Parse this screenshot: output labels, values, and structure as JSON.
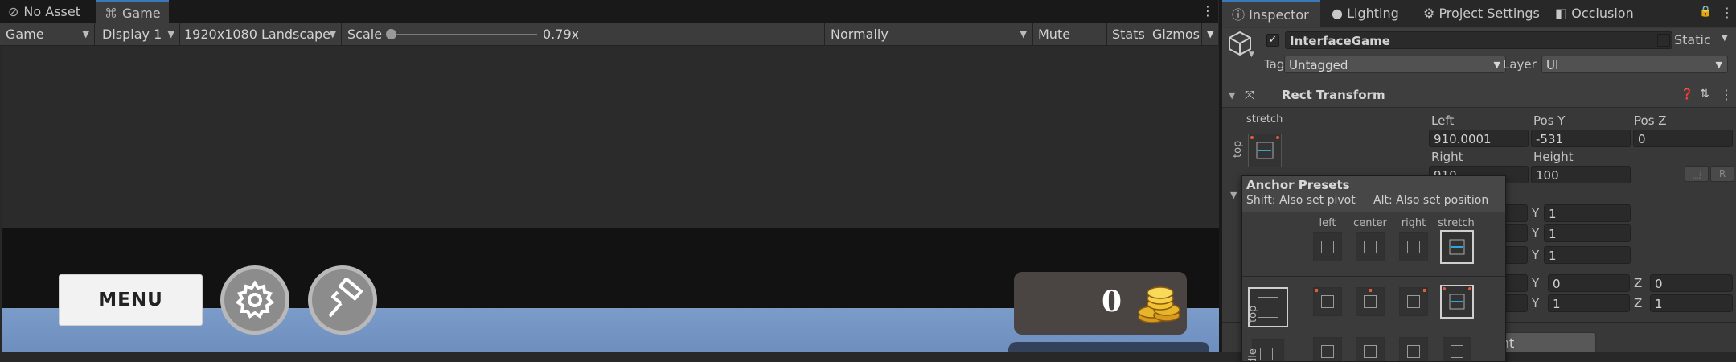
{
  "game_panel": {
    "tabs": [
      {
        "label": "No Asset",
        "icon": "unlink-icon"
      },
      {
        "label": "Game",
        "icon": "gamepad-icon"
      }
    ],
    "toolbar": {
      "view_mode": "Game",
      "display": "Display 1",
      "resolution": "1920x1080 Landscape",
      "scale_label": "Scale",
      "scale_value": "0.79x",
      "play_focus": "Normally",
      "mute_audio": "Mute Audio",
      "stats": "Stats",
      "gizmos": "Gizmos"
    },
    "view": {
      "menu_label": "MENU",
      "coin_count": "0"
    }
  },
  "inspector": {
    "tabs": [
      "Inspector",
      "Lighting",
      "Project Settings",
      "Occlusion"
    ],
    "gameobject": {
      "active": true,
      "name": "InterfaceGame",
      "static_label": "Static",
      "tag_label": "Tag",
      "tag_value": "Untagged",
      "layer_label": "Layer",
      "layer_value": "UI"
    },
    "rect_transform": {
      "title": "Rect Transform",
      "anchor_h": "stretch",
      "anchor_v": "top",
      "left_label": "Left",
      "left_value": "910.0001",
      "posy_label": "Pos Y",
      "posy_value": "-531",
      "posz_label": "Pos Z",
      "posz_value": "0",
      "right_label": "Right",
      "right_value": "910",
      "height_label": "Height",
      "height_value": "100",
      "raw_edit_label": "R",
      "y_rows": [
        {
          "label": "Y",
          "value": "1"
        },
        {
          "label": "Y",
          "value": "1"
        },
        {
          "label": "Y",
          "value": "1"
        }
      ],
      "rot_y_label": "Y",
      "rot_y_value": "0",
      "rot_z_label": "Z",
      "rot_z_value": "0",
      "scale_y_label": "Y",
      "scale_y_value": "1",
      "scale_z_label": "Z",
      "scale_z_value": "1"
    },
    "add_component_partial": "ent"
  },
  "anchor_presets": {
    "title": "Anchor Presets",
    "hint_shift": "Shift: Also set pivot",
    "hint_alt": "Alt: Also set position",
    "columns": [
      "left",
      "center",
      "right",
      "stretch"
    ],
    "rows": [
      "top",
      "middle"
    ],
    "row_middle_partial": "dle"
  },
  "colors": {
    "accent": "#3a79bb",
    "panel_bg": "#383838",
    "game_blue": "#7b9bc9",
    "coin_panel": "#4a4542"
  }
}
